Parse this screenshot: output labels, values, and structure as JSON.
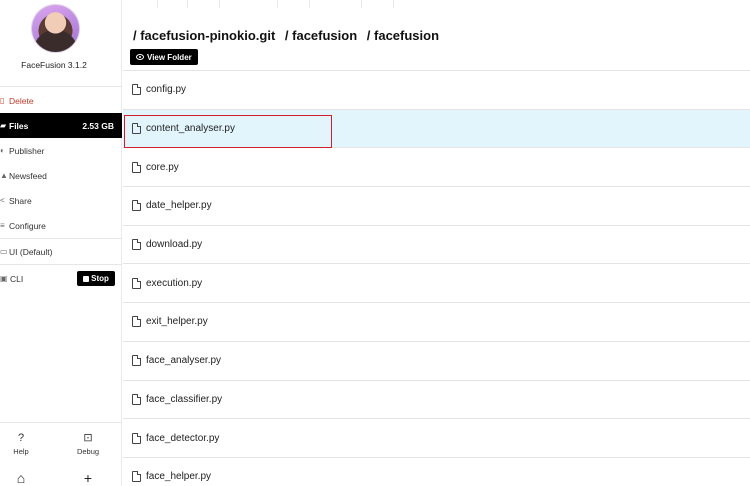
{
  "app": {
    "name": "FaceFusion 3.1.2"
  },
  "sidebar": {
    "items": [
      {
        "label": "Delete",
        "icon": "trash-icon"
      },
      {
        "label": "Files",
        "icon": "folder-icon",
        "badge": "2.53 GB",
        "active": true
      },
      {
        "label": "Publisher",
        "icon": "globe-icon"
      },
      {
        "label": "Newsfeed",
        "icon": "bell-icon"
      },
      {
        "label": "Share",
        "icon": "share-icon"
      },
      {
        "label": "Configure",
        "icon": "sliders-icon"
      },
      {
        "label": "UI (Default)",
        "icon": "window-icon"
      },
      {
        "label": "CLI",
        "icon": "terminal-icon"
      }
    ],
    "stop_label": "Stop",
    "bottom": {
      "help_label": "Help",
      "debug_label": "Debug"
    }
  },
  "breadcrumb": [
    "/ facefusion-pinokio.git",
    "/ facefusion",
    "/ facefusion"
  ],
  "view_folder_label": "View Folder",
  "files": [
    "config.py",
    "content_analyser.py",
    "core.py",
    "date_helper.py",
    "download.py",
    "execution.py",
    "exit_helper.py",
    "face_analyser.py",
    "face_classifier.py",
    "face_detector.py",
    "face_helper.py"
  ],
  "selected_file": "content_analyser.py",
  "colors": {
    "accent": "#000000",
    "selected_row": "#e3f5fc",
    "highlight": "#d0202a",
    "delete": "#c0392b"
  }
}
